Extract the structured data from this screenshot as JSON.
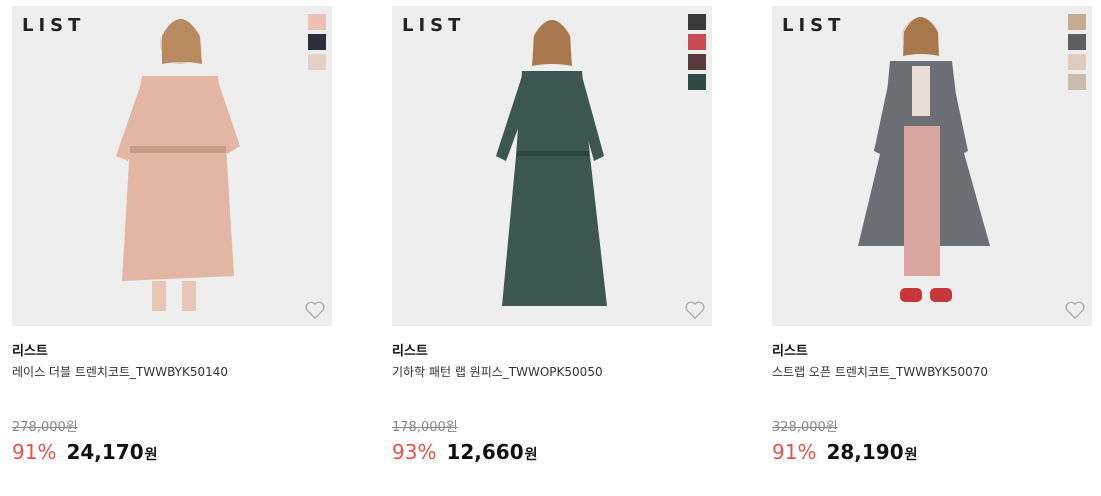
{
  "products": [
    {
      "logo": "LIST",
      "swatches": [
        "#e9c1b4",
        "#2b2f3b",
        "#e2d1c4"
      ],
      "coat_color": "#e2b6a2",
      "brand": "리스트",
      "name": "레이스 더블 트렌치코트_TWWBYK50140",
      "original_price": "278,000원",
      "discount": "91%",
      "price": "24,170",
      "currency": "원"
    },
    {
      "logo": "LIST",
      "swatches": [
        "#3a3a3a",
        "#c84a52",
        "#5a3b3b",
        "#2f4a44"
      ],
      "coat_color": "#3c5652",
      "brand": "리스트",
      "name": "기하학 패턴 랩 원피스_TWWOPK50050",
      "original_price": "178,000원",
      "discount": "93%",
      "price": "12,660",
      "currency": "원"
    },
    {
      "logo": "LIST",
      "swatches": [
        "#c3ac92",
        "#5d5d5f",
        "#ddcbbd",
        "#c9bba9"
      ],
      "coat_color": "#6b6e74",
      "brand": "리스트",
      "name": "스트랩 오픈 트렌치코트_TWWBYK50070",
      "original_price": "328,000원",
      "discount": "91%",
      "price": "28,190",
      "currency": "원"
    }
  ]
}
